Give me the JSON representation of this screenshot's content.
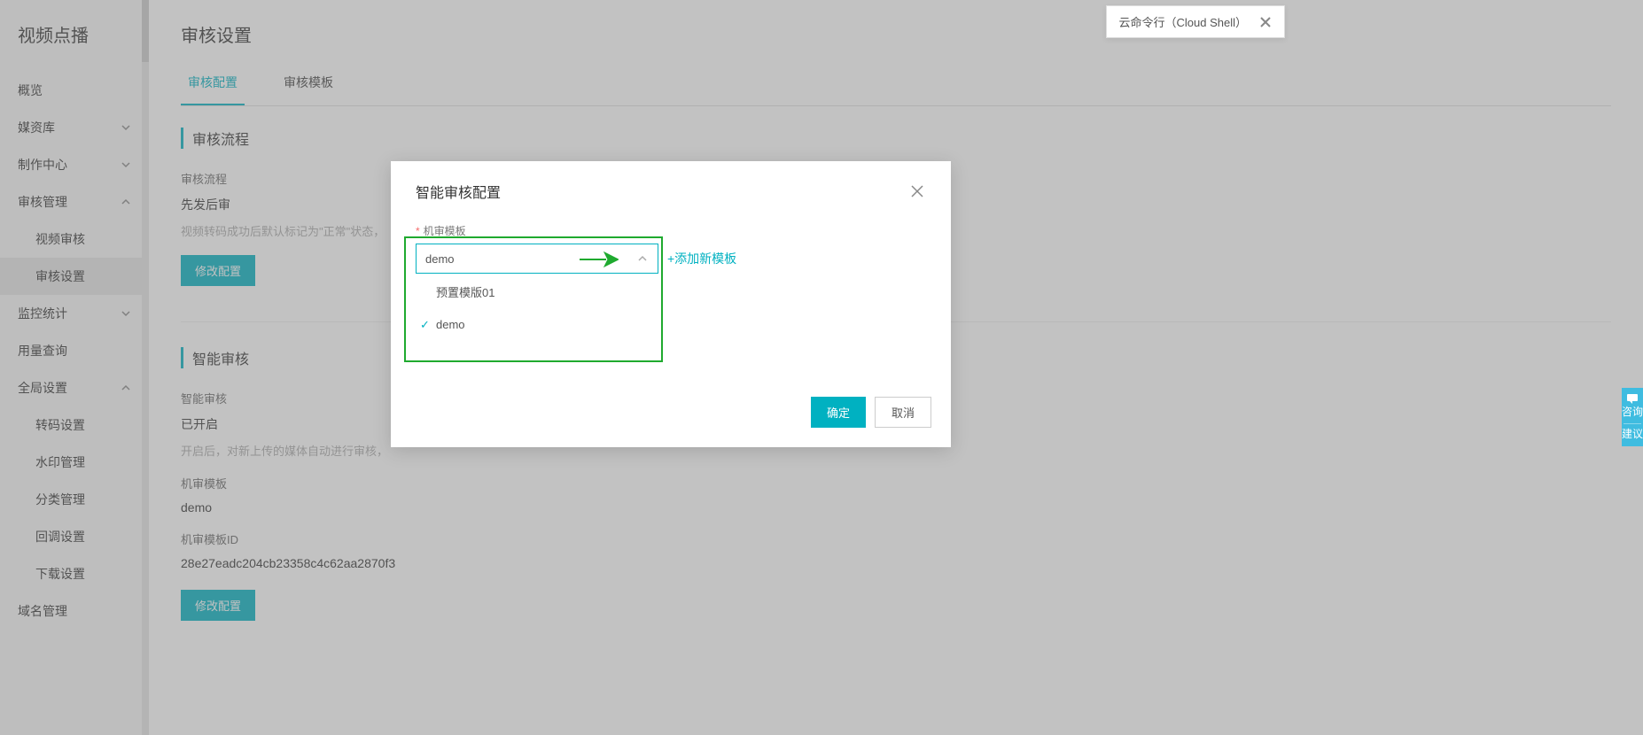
{
  "sidebar": {
    "title": "视频点播",
    "items": [
      {
        "label": "概览"
      },
      {
        "label": "媒资库",
        "chev": "down"
      },
      {
        "label": "制作中心",
        "chev": "down"
      },
      {
        "label": "审核管理",
        "chev": "up"
      },
      {
        "label": "视频审核",
        "sub": true
      },
      {
        "label": "审核设置",
        "sub": true,
        "active": true
      },
      {
        "label": "监控统计",
        "chev": "down"
      },
      {
        "label": "用量查询"
      },
      {
        "label": "全局设置",
        "chev": "up"
      },
      {
        "label": "转码设置",
        "sub": true
      },
      {
        "label": "水印管理",
        "sub": true
      },
      {
        "label": "分类管理",
        "sub": true
      },
      {
        "label": "回调设置",
        "sub": true
      },
      {
        "label": "下载设置",
        "sub": true
      },
      {
        "label": "域名管理"
      }
    ]
  },
  "page": {
    "title": "审核设置"
  },
  "tabs": [
    {
      "label": "审核配置",
      "active": true
    },
    {
      "label": "审核模板"
    }
  ],
  "section1": {
    "head": "审核流程",
    "label": "审核流程",
    "value": "先发后审",
    "desc": "视频转码成功后默认标记为\"正常\"状态，",
    "btn": "修改配置"
  },
  "section2": {
    "head": "智能审核",
    "l1": "智能审核",
    "v1": "已开启",
    "d1": "开启后，对新上传的媒体自动进行审核，",
    "l2": "机审模板",
    "v2": "demo",
    "l3": "机审模板ID",
    "v3": "28e27eadc204cb23358c4c62aa2870f3",
    "btn": "修改配置"
  },
  "modal": {
    "title": "智能审核配置",
    "field_label": "机审模板",
    "select_value": "demo",
    "add_link": "+添加新模板",
    "options": [
      {
        "label": "预置模版01"
      },
      {
        "label": "demo",
        "selected": true
      }
    ],
    "ok": "确定",
    "cancel": "取消"
  },
  "cloud_shell": {
    "text": "云命令行（Cloud Shell）"
  },
  "dock": {
    "t1": "咨询",
    "t2": "建议"
  }
}
